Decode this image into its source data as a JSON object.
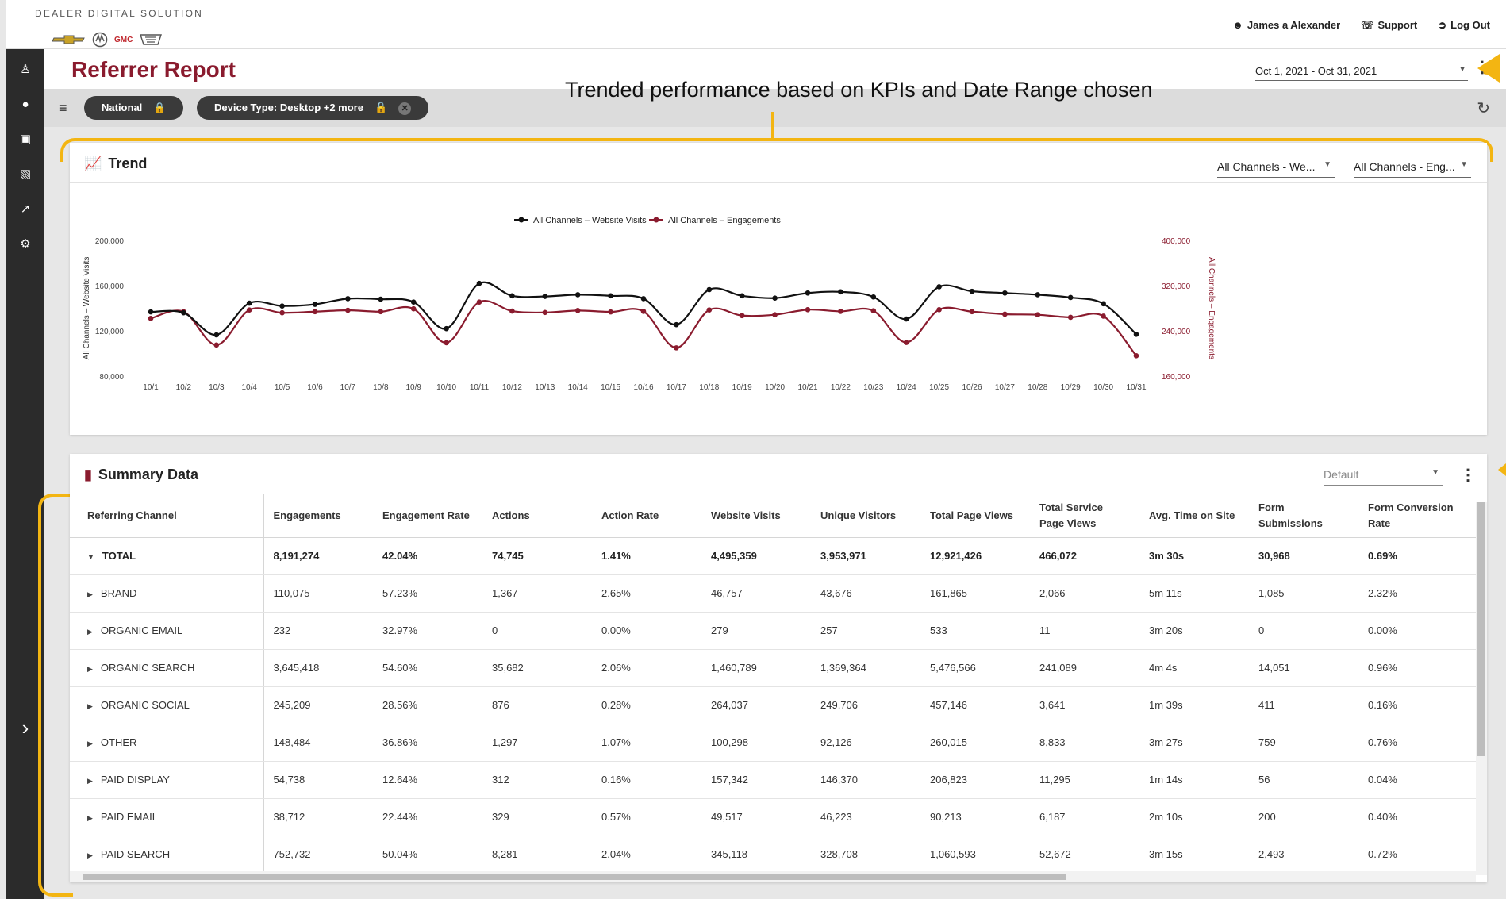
{
  "header": {
    "brand": "DEALER DIGITAL SOLUTION",
    "logos": [
      "chevrolet-logo",
      "buick-logo",
      "GMC",
      "cadillac-logo"
    ],
    "gmc_text": "GMC",
    "user": "James a Alexander",
    "support": "Support",
    "logout": "Log Out"
  },
  "page": {
    "title": "Referrer Report",
    "date_range": "Oct 1, 2021 - Oct 31, 2021"
  },
  "filters": {
    "national": "National",
    "device_type": "Device Type: Desktop +2 more"
  },
  "annotation": {
    "text": "Trended performance based on KPIs and Date Range chosen",
    "accent_color": "#f3b512"
  },
  "trend": {
    "title": "Trend",
    "select_left": "All Channels - We...",
    "select_right": "All Channels - Eng..."
  },
  "chart_data": {
    "type": "line",
    "x": [
      "10/1",
      "10/2",
      "10/3",
      "10/4",
      "10/5",
      "10/6",
      "10/7",
      "10/8",
      "10/9",
      "10/10",
      "10/11",
      "10/12",
      "10/13",
      "10/14",
      "10/15",
      "10/16",
      "10/17",
      "10/18",
      "10/19",
      "10/20",
      "10/21",
      "10/22",
      "10/23",
      "10/24",
      "10/25",
      "10/26",
      "10/27",
      "10/28",
      "10/29",
      "10/30",
      "10/31"
    ],
    "series": [
      {
        "name": "All Channels – Website Visits",
        "axis": "left",
        "color": "#111111",
        "values": [
          136800,
          136000,
          116500,
          144500,
          142000,
          143500,
          148500,
          148000,
          145500,
          122000,
          162000,
          151000,
          150500,
          152000,
          151000,
          148500,
          125500,
          156500,
          151000,
          149000,
          153500,
          154500,
          150000,
          130500,
          159000,
          155000,
          153500,
          152000,
          149500,
          144000,
          117000
        ]
      },
      {
        "name": "All Channels – Engagements",
        "axis": "right",
        "color": "#8a1b2e",
        "values": [
          262000,
          274000,
          215000,
          277000,
          272000,
          274000,
          276500,
          274000,
          279000,
          219000,
          291000,
          275000,
          272500,
          276000,
          273500,
          274500,
          210000,
          277000,
          267000,
          268500,
          277500,
          274500,
          275500,
          219500,
          277500,
          274000,
          269500,
          268500,
          264000,
          266000,
          196000
        ]
      }
    ],
    "yleft": {
      "label": "All Channels – Website Visits",
      "ticks": [
        "200,000",
        "160,000",
        "120,000",
        "80,000"
      ],
      "lim": [
        80000,
        200000
      ]
    },
    "yright": {
      "label": "All Channels – Engagements",
      "ticks": [
        "400,000",
        "320,000",
        "240,000",
        "160,000"
      ],
      "lim": [
        160000,
        400000
      ]
    },
    "legend": "top-center",
    "grid": false
  },
  "summary": {
    "title": "Summary Data",
    "view_select": "Default",
    "columns": [
      "Referring Channel",
      "Engagements",
      "Engagement Rate",
      "Actions",
      "Action Rate",
      "Website Visits",
      "Unique Visitors",
      "Total Page Views",
      "Total Service Page Views",
      "Avg. Time on Site",
      "Form Submissions",
      "Form Conversion Rate"
    ],
    "rows": [
      {
        "cells": [
          "TOTAL",
          "8,191,274",
          "42.04%",
          "74,745",
          "1.41%",
          "4,495,359",
          "3,953,971",
          "12,921,426",
          "466,072",
          "3m 30s",
          "30,968",
          "0.69%"
        ],
        "expanded": true
      },
      {
        "cells": [
          "BRAND",
          "110,075",
          "57.23%",
          "1,367",
          "2.65%",
          "46,757",
          "43,676",
          "161,865",
          "2,066",
          "5m 11s",
          "1,085",
          "2.32%"
        ]
      },
      {
        "cells": [
          "ORGANIC EMAIL",
          "232",
          "32.97%",
          "0",
          "0.00%",
          "279",
          "257",
          "533",
          "11",
          "3m 20s",
          "0",
          "0.00%"
        ]
      },
      {
        "cells": [
          "ORGANIC SEARCH",
          "3,645,418",
          "54.60%",
          "35,682",
          "2.06%",
          "1,460,789",
          "1,369,364",
          "5,476,566",
          "241,089",
          "4m 4s",
          "14,051",
          "0.96%"
        ]
      },
      {
        "cells": [
          "ORGANIC SOCIAL",
          "245,209",
          "28.56%",
          "876",
          "0.28%",
          "264,037",
          "249,706",
          "457,146",
          "3,641",
          "1m 39s",
          "411",
          "0.16%"
        ]
      },
      {
        "cells": [
          "OTHER",
          "148,484",
          "36.86%",
          "1,297",
          "1.07%",
          "100,298",
          "92,126",
          "260,015",
          "8,833",
          "3m 27s",
          "759",
          "0.76%"
        ]
      },
      {
        "cells": [
          "PAID DISPLAY",
          "54,738",
          "12.64%",
          "312",
          "0.16%",
          "157,342",
          "146,370",
          "206,823",
          "11,295",
          "1m 14s",
          "56",
          "0.04%"
        ]
      },
      {
        "cells": [
          "PAID EMAIL",
          "38,712",
          "22.44%",
          "329",
          "0.57%",
          "49,517",
          "46,223",
          "90,213",
          "6,187",
          "2m 10s",
          "200",
          "0.40%"
        ]
      },
      {
        "cells": [
          "PAID SEARCH",
          "752,732",
          "50.04%",
          "8,281",
          "2.04%",
          "345,118",
          "328,708",
          "1,060,593",
          "52,672",
          "3m 15s",
          "2,493",
          "0.72%"
        ]
      }
    ]
  },
  "colors": {
    "brand": "#8a1b2e",
    "sidebar": "#2b2b2b",
    "lock": "#e5a013"
  }
}
